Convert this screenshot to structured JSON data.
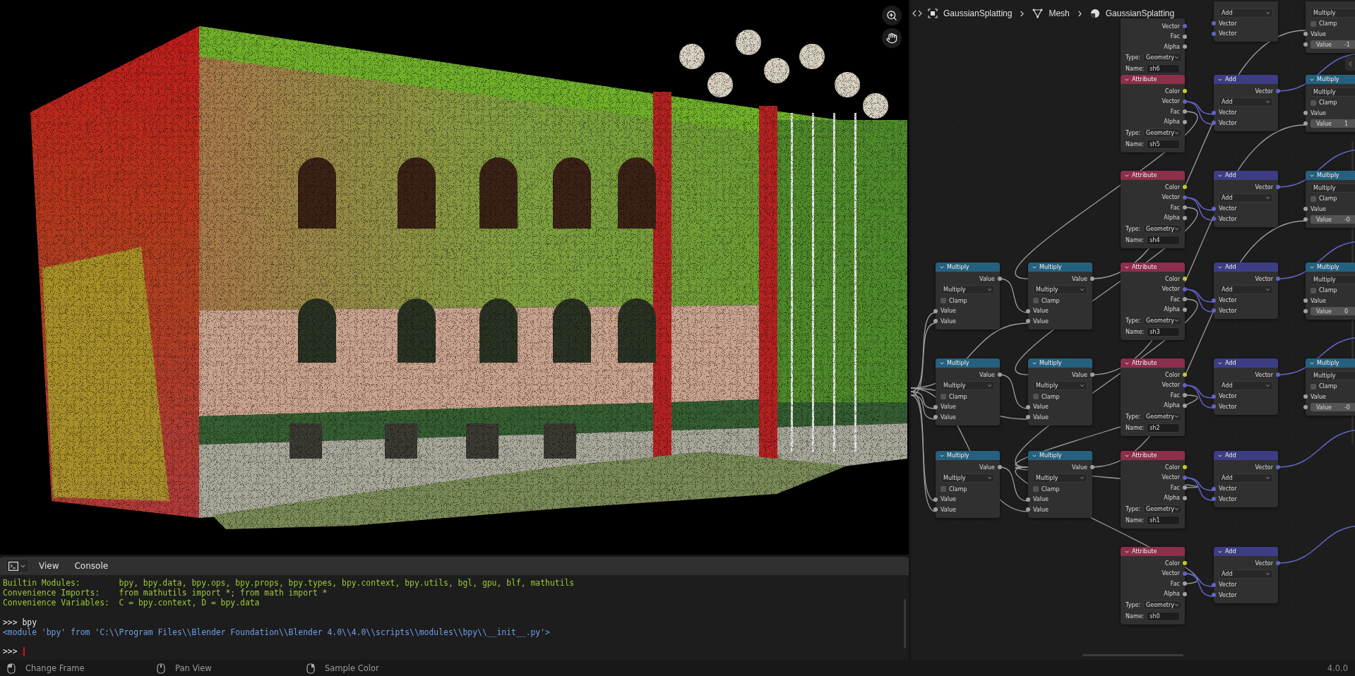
{
  "node_editor": {
    "breadcrumbs": [
      {
        "kind": "object",
        "label": "GaussianSplatting"
      },
      {
        "kind": "mesh",
        "label": "Mesh"
      },
      {
        "kind": "material",
        "label": "GaussianSplatting"
      }
    ],
    "columns": [
      {
        "nodes": [
          {
            "kind": "math",
            "title": "Multiply",
            "rows": [
              {
                "kind": "output",
                "label": "Value",
                "color": "#a1a1a1"
              },
              {
                "kind": "select",
                "value": "Multiply"
              },
              {
                "kind": "checkbox",
                "label": "Clamp",
                "checked": false
              },
              {
                "kind": "input",
                "label": "Value",
                "color": "#a1a1a1"
              },
              {
                "kind": "input",
                "label": "Value",
                "color": "#a1a1a1"
              }
            ]
          },
          {
            "kind": "math",
            "title": "Multiply",
            "rows": [
              {
                "kind": "output",
                "label": "Value",
                "color": "#a1a1a1"
              },
              {
                "kind": "select",
                "value": "Multiply"
              },
              {
                "kind": "checkbox",
                "label": "Clamp",
                "checked": false
              },
              {
                "kind": "input",
                "label": "Value",
                "color": "#a1a1a1"
              },
              {
                "kind": "input",
                "label": "Value",
                "color": "#a1a1a1"
              }
            ]
          },
          {
            "kind": "math",
            "title": "Multiply",
            "rows": [
              {
                "kind": "output",
                "label": "Value",
                "color": "#a1a1a1"
              },
              {
                "kind": "select",
                "value": "Multiply"
              },
              {
                "kind": "checkbox",
                "label": "Clamp",
                "checked": false
              },
              {
                "kind": "input",
                "label": "Value",
                "color": "#a1a1a1"
              },
              {
                "kind": "input",
                "label": "Value",
                "color": "#a1a1a1"
              }
            ]
          }
        ]
      },
      {
        "nodes": [
          {
            "kind": "math",
            "title": "Multiply",
            "rows": [
              {
                "kind": "output",
                "label": "Value",
                "color": "#a1a1a1"
              },
              {
                "kind": "select",
                "value": "Multiply"
              },
              {
                "kind": "checkbox",
                "label": "Clamp",
                "checked": false
              },
              {
                "kind": "input",
                "label": "Value",
                "color": "#a1a1a1"
              },
              {
                "kind": "input",
                "label": "Value",
                "color": "#a1a1a1"
              }
            ]
          },
          {
            "kind": "math",
            "title": "Multiply",
            "rows": [
              {
                "kind": "output",
                "label": "Value",
                "color": "#a1a1a1"
              },
              {
                "kind": "select",
                "value": "Multiply"
              },
              {
                "kind": "checkbox",
                "label": "Clamp",
                "checked": false
              },
              {
                "kind": "input",
                "label": "Value",
                "color": "#a1a1a1"
              },
              {
                "kind": "input",
                "label": "Value",
                "color": "#a1a1a1"
              }
            ]
          },
          {
            "kind": "math",
            "title": "Multiply",
            "rows": [
              {
                "kind": "output",
                "label": "Value",
                "color": "#a1a1a1"
              },
              {
                "kind": "select",
                "value": "Multiply"
              },
              {
                "kind": "checkbox",
                "label": "Clamp",
                "checked": false
              },
              {
                "kind": "input",
                "label": "Value",
                "color": "#a1a1a1"
              },
              {
                "kind": "input",
                "label": "Value",
                "color": "#a1a1a1"
              }
            ]
          }
        ]
      },
      {
        "nodes": [
          {
            "kind": "attribute",
            "rows": [
              {
                "kind": "output",
                "label": "Vector",
                "color": "#6363c7"
              },
              {
                "kind": "output",
                "label": "Fac",
                "color": "#a1a1a1"
              },
              {
                "kind": "output",
                "label": "Alpha",
                "color": "#a1a1a1"
              },
              {
                "kind": "select",
                "label": "Type:",
                "value": "Geometry"
              },
              {
                "kind": "text",
                "label": "Name:",
                "value": "sh6"
              }
            ]
          },
          {
            "kind": "attribute",
            "title": "Attribute",
            "rows": [
              {
                "kind": "output",
                "label": "Color",
                "color": "#c7c729"
              },
              {
                "kind": "output",
                "label": "Vector",
                "color": "#6363c7"
              },
              {
                "kind": "output",
                "label": "Fac",
                "color": "#a1a1a1"
              },
              {
                "kind": "output",
                "label": "Alpha",
                "color": "#a1a1a1"
              },
              {
                "kind": "select",
                "label": "Type:",
                "value": "Geometry"
              },
              {
                "kind": "text",
                "label": "Name:",
                "value": "sh5"
              }
            ]
          },
          {
            "kind": "attribute",
            "title": "Attribute",
            "rows": [
              {
                "kind": "output",
                "label": "Color",
                "color": "#c7c729"
              },
              {
                "kind": "output",
                "label": "Vector",
                "color": "#6363c7"
              },
              {
                "kind": "output",
                "label": "Fac",
                "color": "#a1a1a1"
              },
              {
                "kind": "output",
                "label": "Alpha",
                "color": "#a1a1a1"
              },
              {
                "kind": "select",
                "label": "Type:",
                "value": "Geometry"
              },
              {
                "kind": "text",
                "label": "Name:",
                "value": "sh4"
              }
            ]
          },
          {
            "kind": "attribute",
            "title": "Attribute",
            "rows": [
              {
                "kind": "output",
                "label": "Color",
                "color": "#c7c729"
              },
              {
                "kind": "output",
                "label": "Vector",
                "color": "#6363c7"
              },
              {
                "kind": "output",
                "label": "Fac",
                "color": "#a1a1a1"
              },
              {
                "kind": "output",
                "label": "Alpha",
                "color": "#a1a1a1"
              },
              {
                "kind": "select",
                "label": "Type:",
                "value": "Geometry"
              },
              {
                "kind": "text",
                "label": "Name:",
                "value": "sh3"
              }
            ]
          },
          {
            "kind": "attribute",
            "title": "Attribute",
            "rows": [
              {
                "kind": "output",
                "label": "Color",
                "color": "#c7c729"
              },
              {
                "kind": "output",
                "label": "Vector",
                "color": "#6363c7"
              },
              {
                "kind": "output",
                "label": "Fac",
                "color": "#a1a1a1"
              },
              {
                "kind": "output",
                "label": "Alpha",
                "color": "#a1a1a1"
              },
              {
                "kind": "select",
                "label": "Type:",
                "value": "Geometry"
              },
              {
                "kind": "text",
                "label": "Name:",
                "value": "sh2"
              }
            ]
          },
          {
            "kind": "attribute",
            "title": "Attribute",
            "rows": [
              {
                "kind": "output",
                "label": "Color",
                "color": "#c7c729"
              },
              {
                "kind": "output",
                "label": "Vector",
                "color": "#6363c7"
              },
              {
                "kind": "output",
                "label": "Fac",
                "color": "#a1a1a1"
              },
              {
                "kind": "output",
                "label": "Alpha",
                "color": "#a1a1a1"
              },
              {
                "kind": "select",
                "label": "Type:",
                "value": "Geometry"
              },
              {
                "kind": "text",
                "label": "Name:",
                "value": "sh1"
              }
            ]
          },
          {
            "kind": "attribute",
            "title": "Attribute",
            "rows": [
              {
                "kind": "output",
                "label": "Color",
                "color": "#c7c729"
              },
              {
                "kind": "output",
                "label": "Vector",
                "color": "#6363c7"
              },
              {
                "kind": "output",
                "label": "Fac",
                "color": "#a1a1a1"
              },
              {
                "kind": "output",
                "label": "Alpha",
                "color": "#a1a1a1"
              },
              {
                "kind": "select",
                "label": "Type:",
                "value": "Geometry"
              },
              {
                "kind": "text",
                "label": "Name:",
                "value": "sh0"
              }
            ]
          }
        ]
      },
      {
        "nodes": [
          {
            "kind": "vector_math",
            "rows": [
              {
                "kind": "select",
                "value": "Add"
              },
              {
                "kind": "input",
                "label": "Vector",
                "color": "#6363c7"
              },
              {
                "kind": "input",
                "label": "Vector",
                "color": "#6363c7"
              }
            ]
          },
          {
            "kind": "vector_math",
            "title": "Add",
            "rows": [
              {
                "kind": "output",
                "label": "Vector",
                "color": "#6363c7"
              },
              {
                "kind": "select",
                "value": "Add"
              },
              {
                "kind": "input",
                "label": "Vector",
                "color": "#6363c7"
              },
              {
                "kind": "input",
                "label": "Vector",
                "color": "#6363c7"
              }
            ]
          },
          {
            "kind": "vector_math",
            "title": "Add",
            "rows": [
              {
                "kind": "output",
                "label": "Vector",
                "color": "#6363c7"
              },
              {
                "kind": "select",
                "value": "Add"
              },
              {
                "kind": "input",
                "label": "Vector",
                "color": "#6363c7"
              },
              {
                "kind": "input",
                "label": "Vector",
                "color": "#6363c7"
              }
            ]
          },
          {
            "kind": "vector_math",
            "title": "Add",
            "rows": [
              {
                "kind": "output",
                "label": "Vector",
                "color": "#6363c7"
              },
              {
                "kind": "select",
                "value": "Add"
              },
              {
                "kind": "input",
                "label": "Vector",
                "color": "#6363c7"
              },
              {
                "kind": "input",
                "label": "Vector",
                "color": "#6363c7"
              }
            ]
          },
          {
            "kind": "vector_math",
            "title": "Add",
            "rows": [
              {
                "kind": "output",
                "label": "Vector",
                "color": "#6363c7"
              },
              {
                "kind": "select",
                "value": "Add"
              },
              {
                "kind": "input",
                "label": "Vector",
                "color": "#6363c7"
              },
              {
                "kind": "input",
                "label": "Vector",
                "color": "#6363c7"
              }
            ]
          },
          {
            "kind": "vector_math",
            "title": "Add",
            "rows": [
              {
                "kind": "output",
                "label": "Vector",
                "color": "#6363c7"
              },
              {
                "kind": "select",
                "value": "Add"
              },
              {
                "kind": "input",
                "label": "Vector",
                "color": "#6363c7"
              },
              {
                "kind": "input",
                "label": "Vector",
                "color": "#6363c7"
              }
            ]
          },
          {
            "kind": "vector_math",
            "title": "Add",
            "rows": [
              {
                "kind": "output",
                "label": "Vector",
                "color": "#6363c7"
              },
              {
                "kind": "select",
                "value": "Add"
              },
              {
                "kind": "input",
                "label": "Vector",
                "color": "#6363c7"
              },
              {
                "kind": "input",
                "label": "Vector",
                "color": "#6363c7"
              }
            ]
          }
        ]
      },
      {
        "nodes": [
          {
            "kind": "math",
            "rows": [
              {
                "kind": "select",
                "value": "Multiply"
              },
              {
                "kind": "checkbox",
                "label": "Clamp",
                "checked": false
              },
              {
                "kind": "input",
                "label": "Value",
                "color": "#a1a1a1"
              },
              {
                "kind": "number",
                "label": "Value",
                "value": "-1",
                "color": "#a1a1a1"
              }
            ]
          },
          {
            "kind": "math",
            "title": "Multiply",
            "rows": [
              {
                "kind": "select",
                "value": "Multiply"
              },
              {
                "kind": "checkbox",
                "label": "Clamp",
                "checked": false
              },
              {
                "kind": "input",
                "label": "Value",
                "color": "#a1a1a1"
              },
              {
                "kind": "number",
                "label": "Value",
                "value": "1",
                "color": "#a1a1a1"
              }
            ]
          },
          {
            "kind": "math",
            "title": "Multiply",
            "rows": [
              {
                "kind": "select",
                "value": "Multiply"
              },
              {
                "kind": "checkbox",
                "label": "Clamp",
                "checked": false
              },
              {
                "kind": "input",
                "label": "Value",
                "color": "#a1a1a1"
              },
              {
                "kind": "number",
                "label": "Value",
                "value": "-0",
                "color": "#a1a1a1"
              }
            ]
          },
          {
            "kind": "math",
            "title": "Multiply",
            "rows": [
              {
                "kind": "select",
                "value": "Multiply"
              },
              {
                "kind": "checkbox",
                "label": "Clamp",
                "checked": false
              },
              {
                "kind": "input",
                "label": "Value",
                "color": "#a1a1a1"
              },
              {
                "kind": "number",
                "label": "Value",
                "value": "0",
                "color": "#a1a1a1"
              }
            ]
          },
          {
            "kind": "math",
            "title": "Multiply",
            "rows": [
              {
                "kind": "select",
                "value": "Multiply"
              },
              {
                "kind": "checkbox",
                "label": "Clamp",
                "checked": false
              },
              {
                "kind": "input",
                "label": "Value",
                "color": "#a1a1a1"
              },
              {
                "kind": "number",
                "label": "Value",
                "value": "-0",
                "color": "#a1a1a1"
              }
            ]
          }
        ]
      }
    ]
  },
  "console": {
    "menus": [
      "View",
      "Console"
    ],
    "lines": [
      {
        "kind": "info",
        "label": "Builtin Modules:",
        "value": "bpy, bpy.data, bpy.ops, bpy.props, bpy.types, bpy.context, bpy.utils, bgl, gpu, blf, mathutils"
      },
      {
        "kind": "info",
        "label": "Convenience Imports:",
        "value": "from mathutils import *; from math import *"
      },
      {
        "kind": "info",
        "label": "Convenience Variables:",
        "value": "C = bpy.context, D = bpy.data"
      },
      {
        "kind": "input",
        "prompt": ">>>",
        "text": "bpy"
      },
      {
        "kind": "output",
        "text": "<module 'bpy' from 'C:\\\\Program Files\\\\Blender Foundation\\\\Blender 4.0\\\\4.0\\\\scripts\\\\modules\\\\bpy\\\\__init__.py'>"
      },
      {
        "kind": "prompt",
        "prompt": ">>>"
      }
    ]
  },
  "status_bar": {
    "hints": [
      {
        "kind": "left",
        "label": "Change Frame"
      },
      {
        "kind": "middle",
        "label": "Pan View"
      },
      {
        "kind": "right",
        "label": "Sample Color"
      }
    ],
    "version": "4.0.0"
  }
}
